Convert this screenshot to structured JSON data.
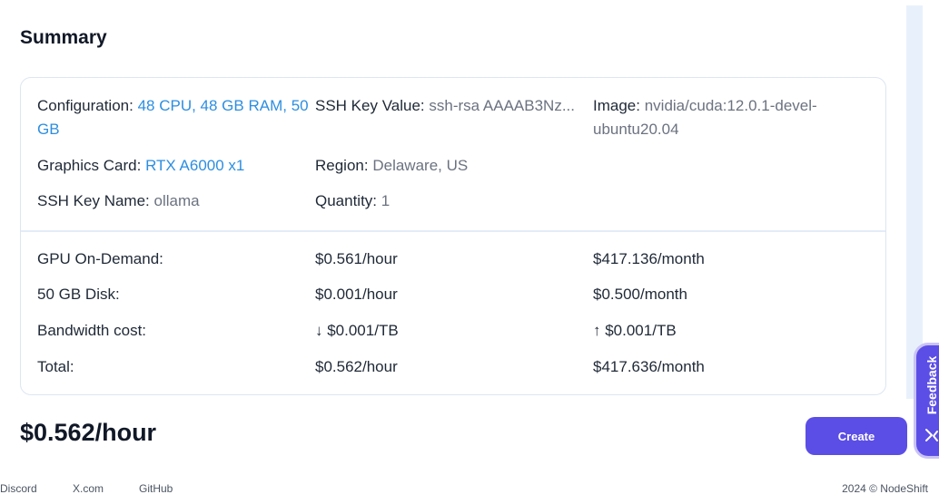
{
  "summary": {
    "title": "Summary",
    "configuration": {
      "label": "Configuration:",
      "value_line1": "48 CPU, 48 GB RAM, 50",
      "value_line2": "GB"
    },
    "ssh_key_value": {
      "label": "SSH Key Value:",
      "value": "ssh-rsa AAAAB3Nz..."
    },
    "image": {
      "label": "Image:",
      "value_line1": "nvidia/cuda:12.0.1-devel-",
      "value_line2": "ubuntu20.04"
    },
    "graphics_card": {
      "label": "Graphics Card:",
      "value": "RTX A6000 x1"
    },
    "region": {
      "label": "Region:",
      "value": "Delaware, US"
    },
    "ssh_key_name": {
      "label": "SSH Key Name:",
      "value": "ollama"
    },
    "quantity": {
      "label": "Quantity:",
      "value": "1"
    }
  },
  "costs": [
    {
      "label": "GPU On-Demand:",
      "hourly": "$0.561/hour",
      "monthly": "$417.136/month"
    },
    {
      "label": "50 GB Disk:",
      "hourly": "$0.001/hour",
      "monthly": "$0.500/month"
    },
    {
      "label": "Bandwidth cost:",
      "hourly": "↓ $0.001/TB",
      "monthly": "↑ $0.001/TB"
    },
    {
      "label": "Total:",
      "hourly": "$0.562/hour",
      "monthly": "$417.636/month"
    }
  ],
  "footer_bar": {
    "total_price": "$0.562/hour",
    "create_label": "Create"
  },
  "feedback": {
    "label": "Feedback",
    "icon": "feedback-icon"
  },
  "footer": {
    "links": [
      "Discord",
      "X.com",
      "GitHub"
    ],
    "copyright": "2024 © NodeShift"
  },
  "colors": {
    "accent": "#5b4ee6",
    "link_value": "#2d8ee0",
    "muted_value": "#6b7280"
  }
}
